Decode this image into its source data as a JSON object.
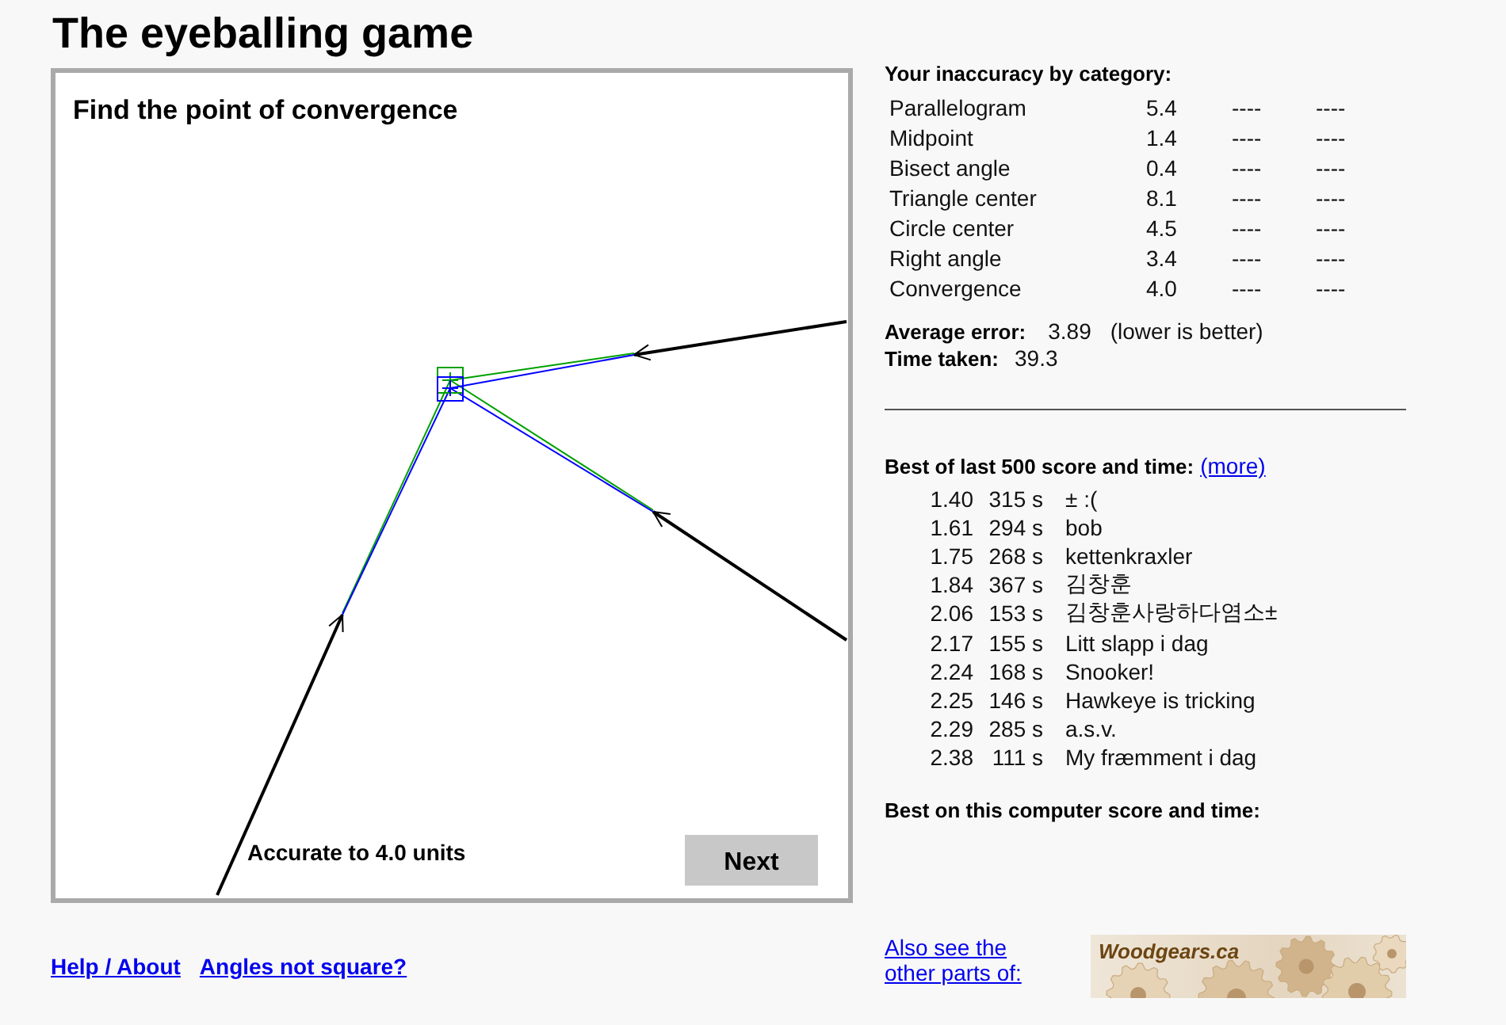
{
  "title": "The eyeballing game",
  "canvas": {
    "prompt": "Find the point of convergence",
    "result": "Accurate to 4.0 units",
    "next_button": "Next"
  },
  "stats": {
    "heading": "Your inaccuracy by category:",
    "categories": [
      {
        "name": "Parallelogram",
        "score": "5.4",
        "column_3": "----",
        "column_4": "----"
      },
      {
        "name": "Midpoint",
        "score": "1.4",
        "column_3": "----",
        "column_4": "----"
      },
      {
        "name": "Bisect angle",
        "score": "0.4",
        "column_3": "----",
        "column_4": "----"
      },
      {
        "name": "Triangle center",
        "score": "8.1",
        "column_3": "----",
        "column_4": "----"
      },
      {
        "name": "Circle center",
        "score": "4.5",
        "column_3": "----",
        "column_4": "----"
      },
      {
        "name": "Right angle",
        "score": "3.4",
        "column_3": "----",
        "column_4": "----"
      },
      {
        "name": "Convergence",
        "score": "4.0",
        "column_3": "----",
        "column_4": "----"
      }
    ],
    "average": {
      "label": "Average error:",
      "value": "3.89",
      "note": "(lower is better)"
    },
    "time": {
      "label": "Time taken:",
      "value": "39.3"
    }
  },
  "leaderboard": {
    "heading": "Best of last 500 score and time:",
    "more_link": "(more)",
    "entries": [
      {
        "score": "1.40",
        "time": "315 s",
        "name": "± :("
      },
      {
        "score": "1.61",
        "time": "294 s",
        "name": "bob"
      },
      {
        "score": "1.75",
        "time": "268 s",
        "name": "kettenkraxler"
      },
      {
        "score": "1.84",
        "time": "367 s",
        "name": "김창훈"
      },
      {
        "score": "2.06",
        "time": "153 s",
        "name": "김창훈사랑하다염소±"
      },
      {
        "score": "2.17",
        "time": "155 s",
        "name": "Litt slapp i dag"
      },
      {
        "score": "2.24",
        "time": "168 s",
        "name": "Snooker!"
      },
      {
        "score": "2.25",
        "time": "146 s",
        "name": "Hawkeye is tricking"
      },
      {
        "score": "2.29",
        "time": "285 s",
        "name": "a.s.v."
      },
      {
        "score": "2.38",
        "time": "111 s",
        "name": "My fræmment i dag"
      }
    ]
  },
  "local_best": {
    "heading": "Best on this computer score and time:"
  },
  "footer": {
    "links": [
      "Help / About",
      "Angles not square?"
    ],
    "also_see": "Also see the other parts of:",
    "logo_text": "Woodgears.ca"
  }
}
